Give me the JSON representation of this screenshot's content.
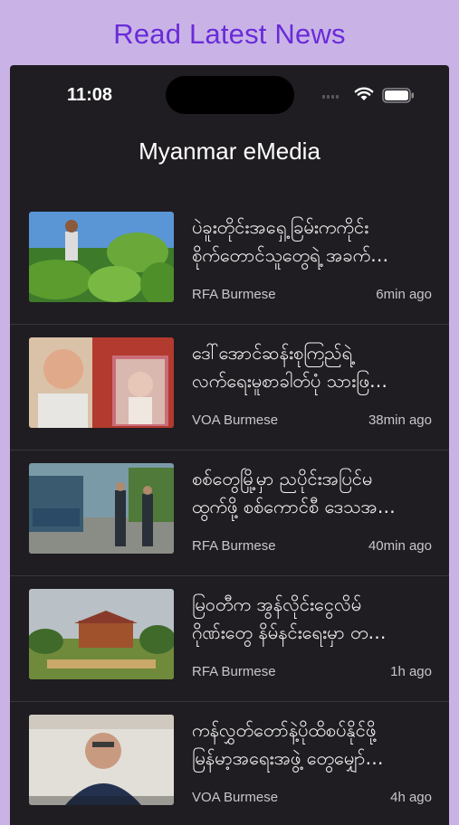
{
  "banner": {
    "title": "Read Latest News"
  },
  "status_bar": {
    "time": "11:08",
    "icons": [
      "signal-icon",
      "wifi-icon",
      "battery-icon"
    ]
  },
  "app": {
    "title": "Myanmar eMedia"
  },
  "colors": {
    "banner_bg": "#c9b3e6",
    "banner_text": "#6a2bd8",
    "phone_bg": "#1f1d21"
  },
  "news": [
    {
      "headline": [
        "ပဲခူးတိုင်းအရှေ့ခြမ်းကကိုင်း",
        "စိုက်တောင်သူတွေရဲ့ အခက်…"
      ],
      "source": "RFA Burmese",
      "time": "6min ago"
    },
    {
      "headline": [
        "ဒေါ်အောင်ဆန်းစုကြည်ရဲ့",
        "လက်ရေးမူစာခါတ်ပုံ သားဖြ…"
      ],
      "source": "VOA Burmese",
      "time": "38min ago"
    },
    {
      "headline": [
        "စစ်တွေမြို့မှာ ညပိုင်းအပြင်မ",
        "ထွက်ဖို့ စစ်ကောင်စီ ဒေသအ…"
      ],
      "source": "RFA Burmese",
      "time": "40min ago"
    },
    {
      "headline": [
        "မြဝတီက အွန်လိုင်းငွေလိမ်",
        "ဂိုဏ်းတွေ နိမ်နင်းရေးမှာ တ…"
      ],
      "source": "RFA Burmese",
      "time": "1h ago"
    },
    {
      "headline": [
        "ကန်လွှတ်တော်နဲ့ပိုထိစပ်နိုင်ဖို့",
        "မြန်မာ့အရေးအဖွဲ့ တွေမျှော်…"
      ],
      "source": "VOA Burmese",
      "time": "4h ago"
    }
  ]
}
